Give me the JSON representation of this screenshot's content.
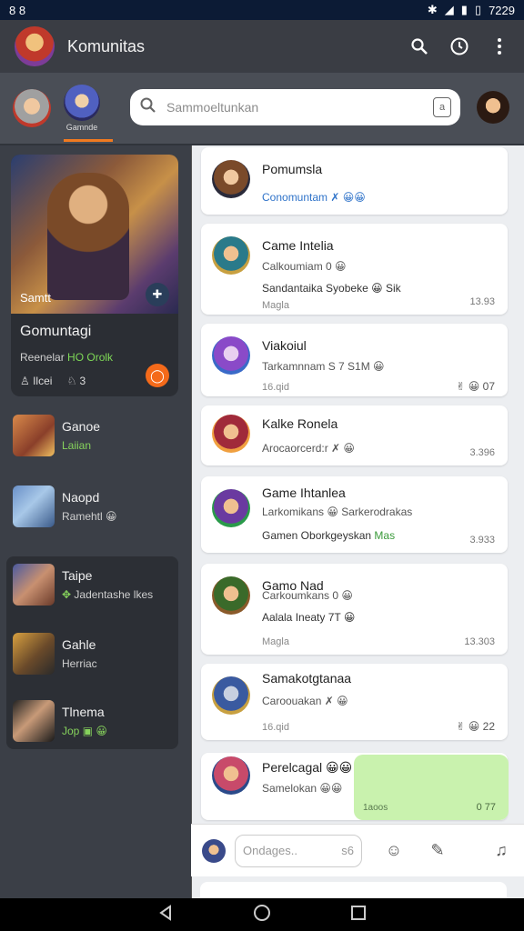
{
  "statusbar": {
    "left": "8 8",
    "time": "7229"
  },
  "appbar": {
    "title": "Komunitas"
  },
  "stories": {
    "active_label": "Gamnde"
  },
  "search": {
    "placeholder": "Sammoeltunkan"
  },
  "sidebar": {
    "featured": {
      "art_label": "Samtt",
      "title": "Gomuntagi",
      "subtitle_prefix": "Reenelar",
      "subtitle_highlight": "HO Orolk",
      "stat1": "Ilcei",
      "stat2": "3"
    },
    "items": [
      {
        "title": "Ganoe",
        "subtitle": "Laiian"
      },
      {
        "title": "Naopd",
        "subtitle": "Ramehtl"
      },
      {
        "title": "Taipe",
        "subtitle": "Jadentashe lkes"
      },
      {
        "title": "Gahle",
        "subtitle": "Herriac"
      },
      {
        "title": "Tlnema",
        "subtitle": "Jop"
      }
    ]
  },
  "chats": [
    {
      "name": "Pomumsla",
      "line2": "Conomuntam",
      "line3": "",
      "meta": "",
      "time": "",
      "react": ""
    },
    {
      "name": "Came Intelia",
      "line2": "Calkoumiam 0",
      "line3": "Sandantaika Syobeke",
      "line3_suffix": "Sik",
      "meta": "Magla",
      "time": "13.93",
      "react": ""
    },
    {
      "name": "Viakoiul",
      "line2": "Tarkamnnam S 7 S1M",
      "line3": "",
      "meta": "16.qid",
      "time": "",
      "react": "07"
    },
    {
      "name": "Kalke Ronela",
      "line2": "Arocaorcerd:r",
      "line3": "",
      "meta": "",
      "time": "3.396",
      "react": ""
    },
    {
      "name": "Game Ihtanlea",
      "line2": "Larkomikans",
      "line2_suffix": "Sarkerodrakas",
      "line3": "Gamen Oborkgeyskan",
      "line3_suffix": "Mas",
      "meta": "",
      "time": "3.933",
      "react": ""
    },
    {
      "name": "Gamo Nad",
      "line2": "Carkoumkans 0",
      "line3": "Aalala Ineaty 7T",
      "meta": "Magla",
      "time": "13.303",
      "react": ""
    },
    {
      "name": "Samakotgtanaa",
      "line2": "Caroouakan",
      "line3": "",
      "meta": "16.qid",
      "time": "",
      "react": "22"
    },
    {
      "name": "Perelcagal",
      "line2": "Samelokan",
      "line3": "",
      "meta": "",
      "time": "",
      "react": ""
    }
  ],
  "green_bubble": {
    "ts": "1aoos",
    "count": "0 77"
  },
  "composer": {
    "placeholder": "Ondages..",
    "counter": "s6"
  },
  "colors": {
    "accent": "#f07a20",
    "bg_dark": "#30343b",
    "green": "#c9f2ae",
    "link": "#2f73c9"
  }
}
